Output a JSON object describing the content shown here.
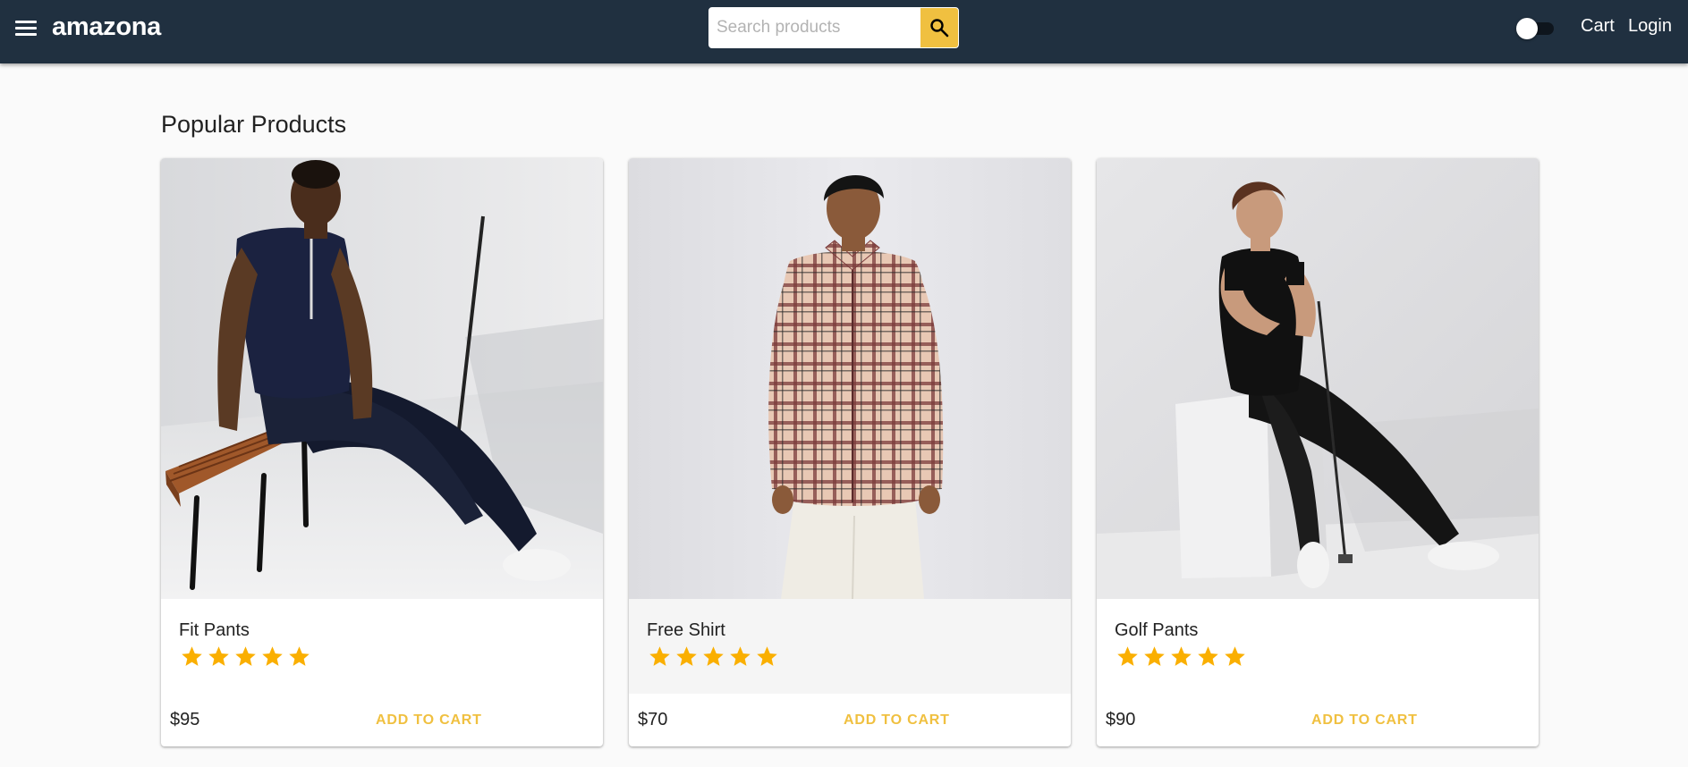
{
  "header": {
    "brand": "amazona",
    "search_placeholder": "Search products",
    "search_value": "",
    "dark_mode_on": false,
    "cart_label": "Cart",
    "login_label": "Login"
  },
  "main": {
    "section_title": "Popular Products",
    "products": [
      {
        "name": "Fit Pants",
        "rating": 5,
        "price": "$95",
        "add_label": "Add to cart",
        "image": "man seated on a wooden bench wearing a navy polo shirt and navy pants"
      },
      {
        "name": "Free Shirt",
        "rating": 5,
        "price": "$70",
        "add_label": "Add to cart",
        "image": "man standing wearing a checked button-down shirt and cream trousers"
      },
      {
        "name": "Golf Pants",
        "rating": 5,
        "price": "$90",
        "add_label": "Add to cart",
        "image": "man leaning on a white block holding a golf club, wearing black polo and black pants"
      }
    ]
  },
  "colors": {
    "appbar": "#203040",
    "accent": "#f0c040",
    "star": "#faaf00",
    "background": "#fafafa"
  }
}
